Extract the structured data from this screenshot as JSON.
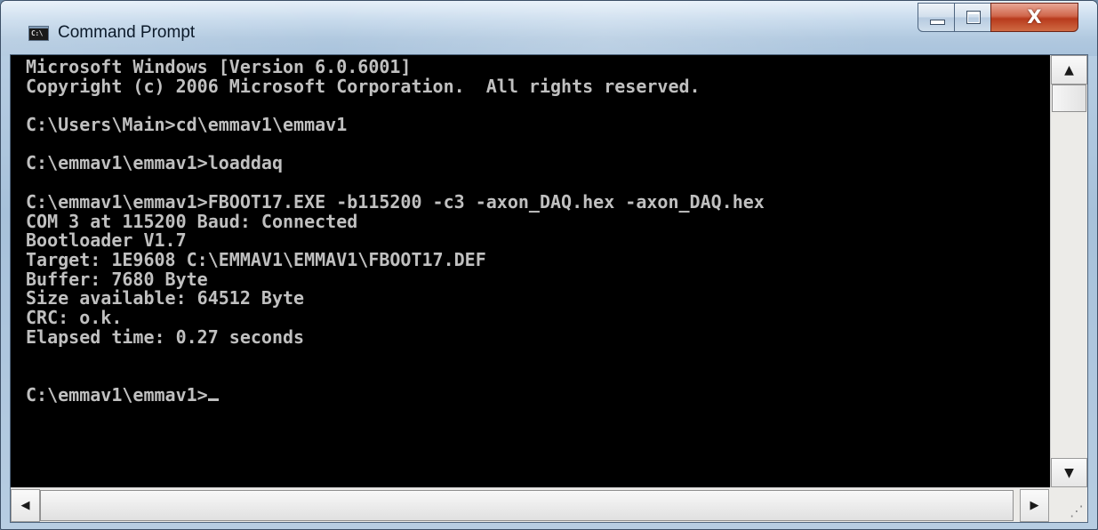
{
  "window": {
    "title": "Command Prompt",
    "icon": "console-app-icon",
    "icon_text": "C:\\"
  },
  "controls": {
    "minimize": "minimize-icon",
    "maximize": "maximize-icon",
    "close": "close-icon",
    "close_glyph": "X"
  },
  "console": {
    "lines": [
      "Microsoft Windows [Version 6.0.6001]",
      "Copyright (c) 2006 Microsoft Corporation.  All rights reserved.",
      "",
      "C:\\Users\\Main>cd\\emmav1\\emmav1",
      "",
      "C:\\emmav1\\emmav1>loaddaq",
      "",
      "C:\\emmav1\\emmav1>FBOOT17.EXE -b115200 -c3 -axon_DAQ.hex -axon_DAQ.hex",
      "COM 3 at 115200 Baud: Connected",
      "Bootloader V1.7",
      "Target: 1E9608 C:\\EMMAV1\\EMMAV1\\FBOOT17.DEF",
      "Buffer: 7680 Byte",
      "Size available: 64512 Byte",
      "CRC: o.k.",
      "Elapsed time: 0.27 seconds",
      "",
      "",
      "C:\\emmav1\\emmav1>"
    ],
    "text_color": "#c0c0c0",
    "background_color": "#000000"
  },
  "scrollbars": {
    "up_arrow": "▲",
    "down_arrow": "▼",
    "left_arrow": "◀",
    "right_arrow": "▶",
    "grip": "⋰"
  }
}
